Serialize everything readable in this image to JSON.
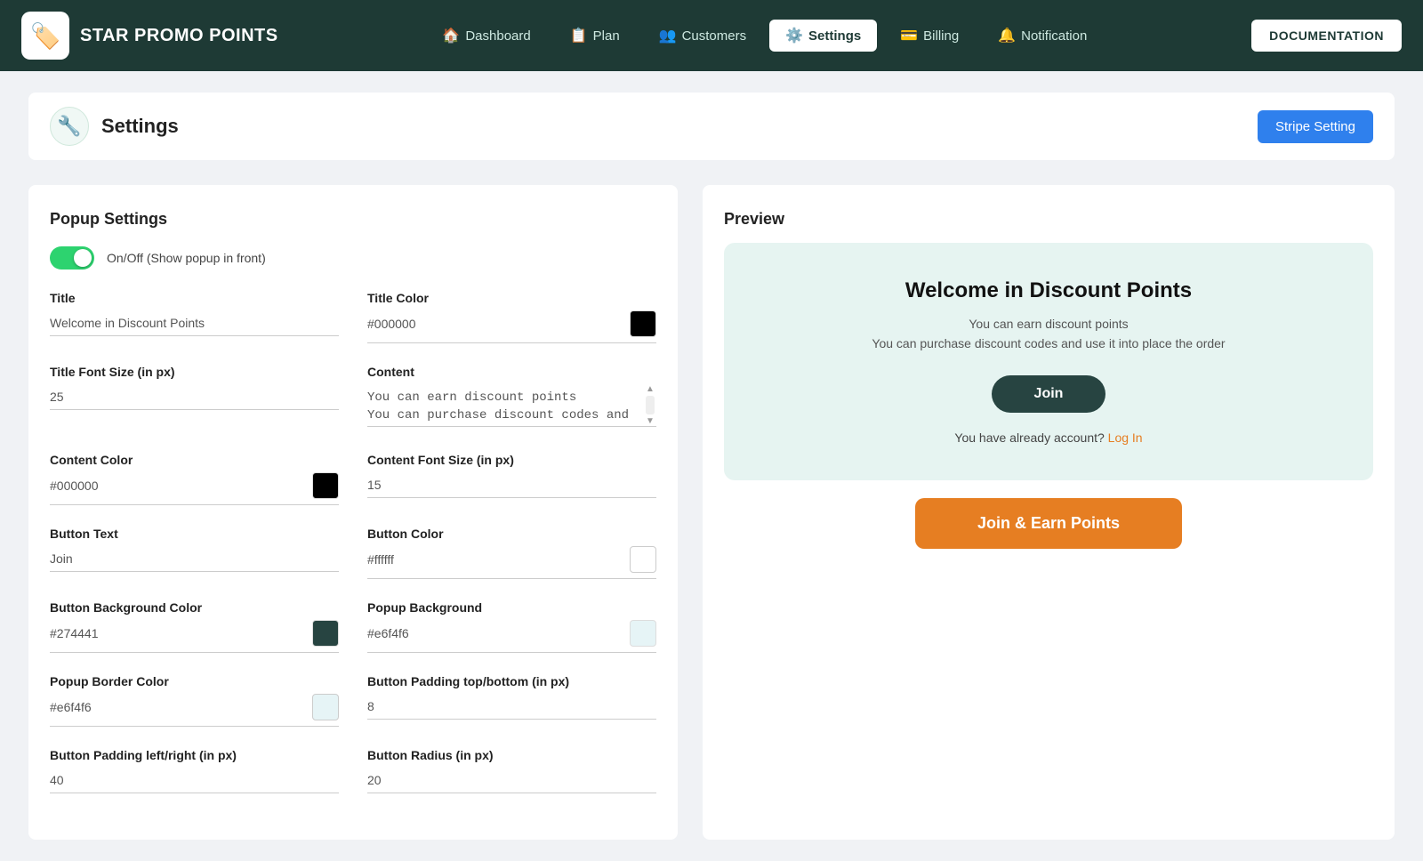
{
  "app": {
    "name": "STAR PROMO POINTS",
    "logo_emoji": "🏷️"
  },
  "nav": {
    "items": [
      {
        "label": "Dashboard",
        "icon": "🏠",
        "active": false
      },
      {
        "label": "Plan",
        "icon": "📋",
        "active": false
      },
      {
        "label": "Customers",
        "icon": "👥",
        "active": false
      },
      {
        "label": "Settings",
        "icon": "⚙️",
        "active": true
      },
      {
        "label": "Billing",
        "icon": "💳",
        "active": false
      },
      {
        "label": "Notification",
        "icon": "🔔",
        "active": false
      }
    ],
    "doc_button": "DOCUMENTATION"
  },
  "header": {
    "title": "Settings",
    "stripe_btn": "Stripe Setting"
  },
  "popup_settings": {
    "section_title": "Popup Settings",
    "toggle_label": "On/Off (Show popup in front)",
    "fields": {
      "title_label": "Title",
      "title_value": "Welcome in Discount Points",
      "title_color_label": "Title Color",
      "title_color_value": "#000000",
      "title_font_size_label": "Title Font Size (in px)",
      "title_font_size_value": "25",
      "content_label": "Content",
      "content_value": "You can earn discount points\nYou can purchase discount codes and use it into",
      "content_color_label": "Content Color",
      "content_color_value": "#000000",
      "content_font_size_label": "Content Font Size (in px)",
      "content_font_size_value": "15",
      "button_text_label": "Button Text",
      "button_text_value": "Join",
      "button_color_label": "Button Color",
      "button_color_value": "#ffffff",
      "button_bg_color_label": "Button Background Color",
      "button_bg_color_value": "#274441",
      "popup_bg_label": "Popup Background",
      "popup_bg_value": "#e6f4f6",
      "popup_border_color_label": "Popup Border Color",
      "popup_border_color_value": "#e6f4f6",
      "button_padding_tb_label": "Button Padding top/bottom (in px)",
      "button_padding_tb_value": "8",
      "button_padding_lr_label": "Button Padding left/right (in px)",
      "button_padding_lr_value": "40",
      "button_radius_label": "Button Radius (in px)",
      "button_radius_value": "20"
    }
  },
  "preview": {
    "title": "Preview",
    "popup": {
      "title": "Welcome in Discount Points",
      "content_line1": "You can earn discount points",
      "content_line2": "You can purchase discount codes and use it into place the order",
      "join_btn": "Join",
      "account_text": "You have already account?",
      "login_link": "Log In"
    },
    "join_earn_btn": "Join & Earn Points"
  }
}
